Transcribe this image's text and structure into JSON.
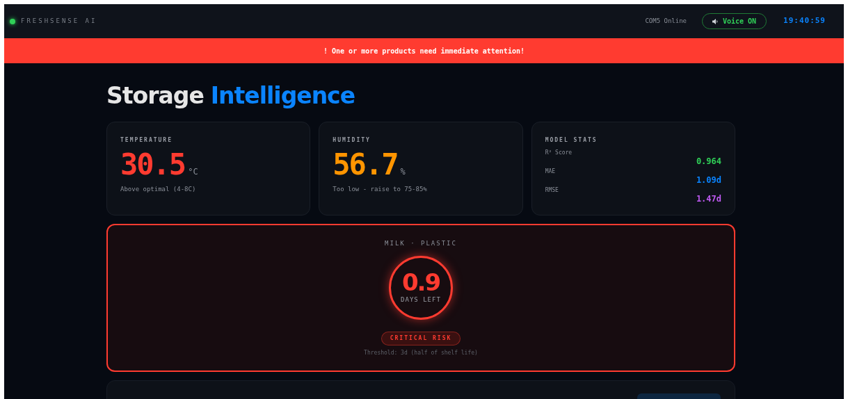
{
  "header": {
    "brand": "FRESHSENSE AI",
    "online": true,
    "port_status": "COM5 Online",
    "voice": {
      "label": "Voice ON",
      "on": true
    },
    "clock": "19:40:59"
  },
  "alert_banner": {
    "icon": "!",
    "text": "One or more products need immediate attention!"
  },
  "title": {
    "first": "Storage",
    "second": "Intelligence"
  },
  "sensor_cards": [
    {
      "label": "TEMPERATURE",
      "value": "30.5",
      "unit": "°C",
      "note": "Above optimal (4-8C)",
      "color": "#ff3b30"
    },
    {
      "label": "HUMIDITY",
      "value": "56.7",
      "unit": "%",
      "note": "Too low - raise to 75-85%",
      "color": "#ff9500"
    }
  ],
  "model_stats": {
    "label": "MODEL STATS",
    "rows": [
      {
        "name": "R² Score",
        "value": "0.964",
        "color": "#30d158"
      },
      {
        "name": "MAE",
        "value": "1.09d",
        "color": "#0a84ff"
      },
      {
        "name": "RMSE",
        "value": "1.47d",
        "color": "#bf5af2"
      }
    ]
  },
  "prediction": {
    "product": "MILK · PLASTIC",
    "days": "0.9",
    "days_label": "DAYS LEFT",
    "kind": "critical",
    "risk_label": "CRITICAL RISK",
    "threshold": "Threshold: 3d (half of shelf life)"
  }
}
